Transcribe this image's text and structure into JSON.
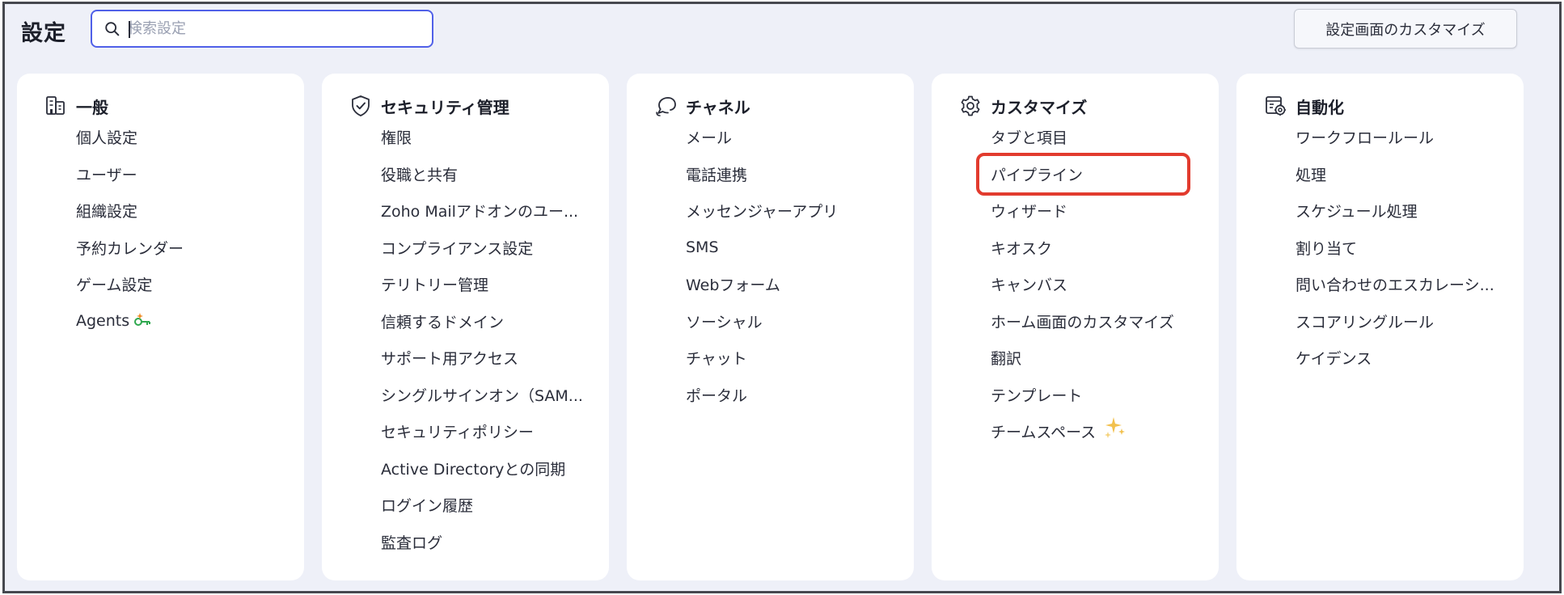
{
  "header": {
    "title": "設定",
    "search_placeholder": "検索設定",
    "customize_button": "設定画面のカスタマイズ"
  },
  "colors": {
    "background": "#eef0f8",
    "card": "#ffffff",
    "search_border": "#5060e8",
    "highlight": "#e23b2e",
    "agent_badge": "#2fa84f",
    "sparkle": "#f2c14e"
  },
  "cards": [
    {
      "icon": "building-icon",
      "title": "一般",
      "items": [
        "個人設定",
        "ユーザー",
        "組織設定",
        "予約カレンダー",
        "ゲーム設定",
        "Agents"
      ]
    },
    {
      "icon": "shield-check-icon",
      "title": "セキュリティ管理",
      "items": [
        "権限",
        "役職と共有",
        "Zoho Mailアドオンのユー...",
        "コンプライアンス設定",
        "テリトリー管理",
        "信頼するドメイン",
        "サポート用アクセス",
        "シングルサインオン（SAM...",
        "セキュリティポリシー",
        "Active Directoryとの同期",
        "ログイン履歴",
        "監査ログ"
      ]
    },
    {
      "icon": "chat-bubbles-icon",
      "title": "チャネル",
      "items": [
        "メール",
        "電話連携",
        "メッセンジャーアプリ",
        "SMS",
        "Webフォーム",
        "ソーシャル",
        "チャット",
        "ポータル"
      ]
    },
    {
      "icon": "gear-icon",
      "title": "カスタマイズ",
      "items": [
        "タブと項目",
        "パイプライン",
        "ウィザード",
        "キオスク",
        "キャンバス",
        "ホーム画面のカスタマイズ",
        "翻訳",
        "テンプレート",
        "チームスペース"
      ]
    },
    {
      "icon": "automation-icon",
      "title": "自動化",
      "items": [
        "ワークフロールール",
        "処理",
        "スケジュール処理",
        "割り当て",
        "問い合わせのエスカレーシ...",
        "スコアリングルール",
        "ケイデンス"
      ]
    }
  ]
}
